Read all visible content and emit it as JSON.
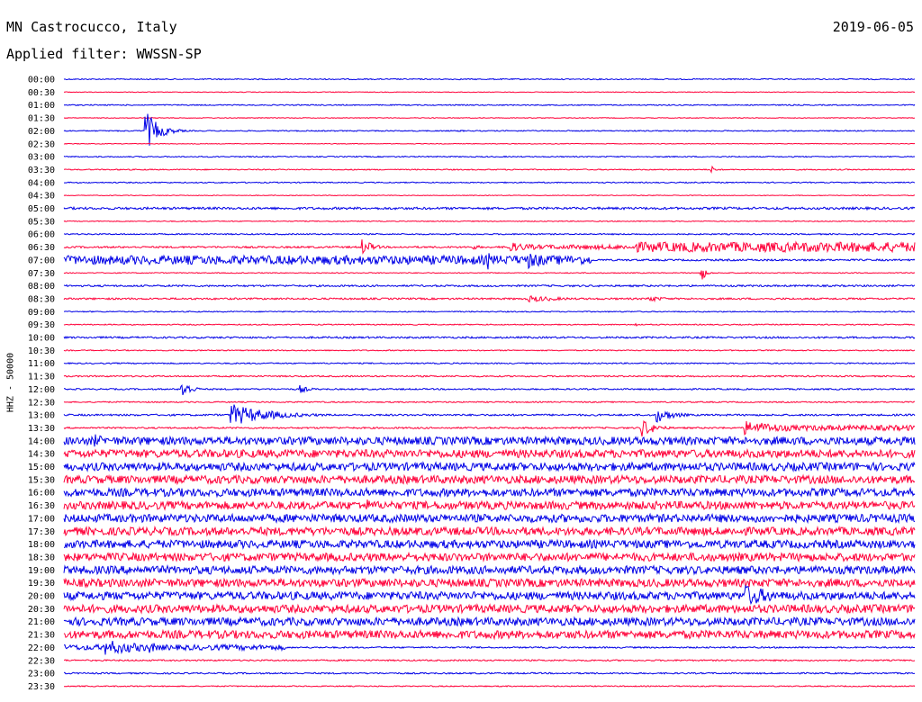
{
  "header": {
    "station": "MN Castrocucco, Italy",
    "date": "2019-06-05",
    "filter": "Applied filter: WWSSN-SP"
  },
  "colors": {
    "a": "#0000e6",
    "b": "#ff0039"
  },
  "chart_data": {
    "type": "line",
    "title": "MN Castrocucco, Italy",
    "ylabel": "HHZ - 50000",
    "rows": [
      {
        "label": "00:00",
        "color": "blue",
        "noise": 0.6
      },
      {
        "label": "00:30",
        "color": "red",
        "noise": 0.4
      },
      {
        "label": "01:00",
        "color": "blue",
        "noise": 0.6
      },
      {
        "label": "01:30",
        "color": "red",
        "noise": 0.4
      },
      {
        "label": "02:00",
        "color": "blue",
        "noise": 0.6,
        "events": [
          {
            "x": 0.095,
            "amp": 24,
            "len": 0.015
          },
          {
            "x": 0.46,
            "amp": 1.2,
            "len": 0.02
          }
        ]
      },
      {
        "label": "02:30",
        "color": "red",
        "noise": 0.4
      },
      {
        "label": "03:00",
        "color": "blue",
        "noise": 0.6
      },
      {
        "label": "03:30",
        "color": "red",
        "noise": 0.6,
        "events": [
          {
            "x": 0.76,
            "amp": 5,
            "len": 0.006
          }
        ]
      },
      {
        "label": "04:00",
        "color": "blue",
        "noise": 0.6
      },
      {
        "label": "04:30",
        "color": "red",
        "noise": 0.4
      },
      {
        "label": "05:00",
        "color": "blue",
        "noise": 1.3
      },
      {
        "label": "05:30",
        "color": "red",
        "noise": 0.5
      },
      {
        "label": "06:00",
        "color": "blue",
        "noise": 0.7
      },
      {
        "label": "06:30",
        "color": "red",
        "noise": 1.0,
        "events": [
          {
            "x": 0.35,
            "amp": 10,
            "len": 0.012
          },
          {
            "x": 0.48,
            "amp": 3,
            "len": 0.012
          },
          {
            "x": 0.52,
            "amp": 6,
            "len": 0.04
          }
        ],
        "sustain": [
          {
            "from": 0.53,
            "to": 0.67,
            "amp": 2.5
          },
          {
            "from": 0.67,
            "to": 1.0,
            "amp": 5.5
          }
        ]
      },
      {
        "label": "07:00",
        "color": "blue",
        "noise": 1.0,
        "sustain": [
          {
            "from": 0.0,
            "to": 0.62,
            "amp": 5
          }
        ],
        "events": [
          {
            "x": 0.498,
            "amp": 11,
            "len": 0.01
          },
          {
            "x": 0.546,
            "amp": 10,
            "len": 0.03
          },
          {
            "x": 0.603,
            "amp": 6,
            "len": 0.008
          }
        ]
      },
      {
        "label": "07:30",
        "color": "red",
        "noise": 0.5,
        "events": [
          {
            "x": 0.748,
            "amp": 13,
            "len": 0.005
          }
        ]
      },
      {
        "label": "08:00",
        "color": "blue",
        "noise": 1.0
      },
      {
        "label": "08:30",
        "color": "red",
        "noise": 1.0,
        "events": [
          {
            "x": 0.545,
            "amp": 4,
            "len": 0.04
          },
          {
            "x": 0.685,
            "amp": 4,
            "len": 0.02
          }
        ]
      },
      {
        "label": "09:00",
        "color": "blue",
        "noise": 0.6
      },
      {
        "label": "09:30",
        "color": "red",
        "noise": 0.6,
        "events": [
          {
            "x": 0.67,
            "amp": 3,
            "len": 0.005
          }
        ]
      },
      {
        "label": "10:00",
        "color": "blue",
        "noise": 1.0
      },
      {
        "label": "10:30",
        "color": "red",
        "noise": 0.6
      },
      {
        "label": "11:00",
        "color": "blue",
        "noise": 0.7
      },
      {
        "label": "11:30",
        "color": "red",
        "noise": 0.8
      },
      {
        "label": "12:00",
        "color": "blue",
        "noise": 0.8,
        "events": [
          {
            "x": 0.137,
            "amp": 14,
            "len": 0.01
          },
          {
            "x": 0.277,
            "amp": 5,
            "len": 0.01
          }
        ]
      },
      {
        "label": "12:30",
        "color": "red",
        "noise": 0.7
      },
      {
        "label": "13:00",
        "color": "blue",
        "noise": 1.0,
        "events": [
          {
            "x": 0.195,
            "amp": 13,
            "len": 0.045
          },
          {
            "x": 0.696,
            "amp": 9,
            "len": 0.02
          }
        ]
      },
      {
        "label": "13:30",
        "color": "red",
        "noise": 0.9,
        "events": [
          {
            "x": 0.678,
            "amp": 12,
            "len": 0.015
          },
          {
            "x": 0.8,
            "amp": 8,
            "len": 0.06
          }
        ],
        "sustain": [
          {
            "from": 0.82,
            "to": 1.0,
            "amp": 3
          }
        ]
      },
      {
        "label": "14:00",
        "color": "blue",
        "noise": 4.5,
        "events": [
          {
            "x": 0.035,
            "amp": 8,
            "len": 0.02
          }
        ]
      },
      {
        "label": "14:30",
        "color": "red",
        "noise": 4.5
      },
      {
        "label": "15:00",
        "color": "blue",
        "noise": 4.5,
        "events": [
          {
            "x": 0.735,
            "amp": 6,
            "len": 0.005
          }
        ]
      },
      {
        "label": "15:30",
        "color": "red",
        "noise": 4.5
      },
      {
        "label": "16:00",
        "color": "blue",
        "noise": 4.5
      },
      {
        "label": "16:30",
        "color": "red",
        "noise": 4.5,
        "events": [
          {
            "x": 0.355,
            "amp": 8,
            "len": 0.01
          }
        ]
      },
      {
        "label": "17:00",
        "color": "blue",
        "noise": 4.5
      },
      {
        "label": "17:30",
        "color": "red",
        "noise": 4.5
      },
      {
        "label": "18:00",
        "color": "blue",
        "noise": 4.5
      },
      {
        "label": "18:30",
        "color": "red",
        "noise": 4.5
      },
      {
        "label": "19:00",
        "color": "blue",
        "noise": 4.5
      },
      {
        "label": "19:30",
        "color": "red",
        "noise": 4.5
      },
      {
        "label": "20:00",
        "color": "blue",
        "noise": 4.5,
        "events": [
          {
            "x": 0.8,
            "amp": 13,
            "len": 0.04
          }
        ]
      },
      {
        "label": "20:30",
        "color": "red",
        "noise": 4.5
      },
      {
        "label": "21:00",
        "color": "blue",
        "noise": 4.5
      },
      {
        "label": "21:30",
        "color": "red",
        "noise": 4.5
      },
      {
        "label": "22:00",
        "color": "blue",
        "noise": 0.8,
        "events": [
          {
            "x": 0.045,
            "amp": 9,
            "len": 0.06
          },
          {
            "x": 0.1,
            "amp": 7,
            "len": 0.015
          }
        ],
        "sustain": [
          {
            "from": 0.0,
            "to": 0.26,
            "amp": 3
          }
        ]
      },
      {
        "label": "22:30",
        "color": "red",
        "noise": 0.8
      },
      {
        "label": "23:00",
        "color": "blue",
        "noise": 0.8
      },
      {
        "label": "23:30",
        "color": "red",
        "noise": 0.6
      }
    ]
  }
}
